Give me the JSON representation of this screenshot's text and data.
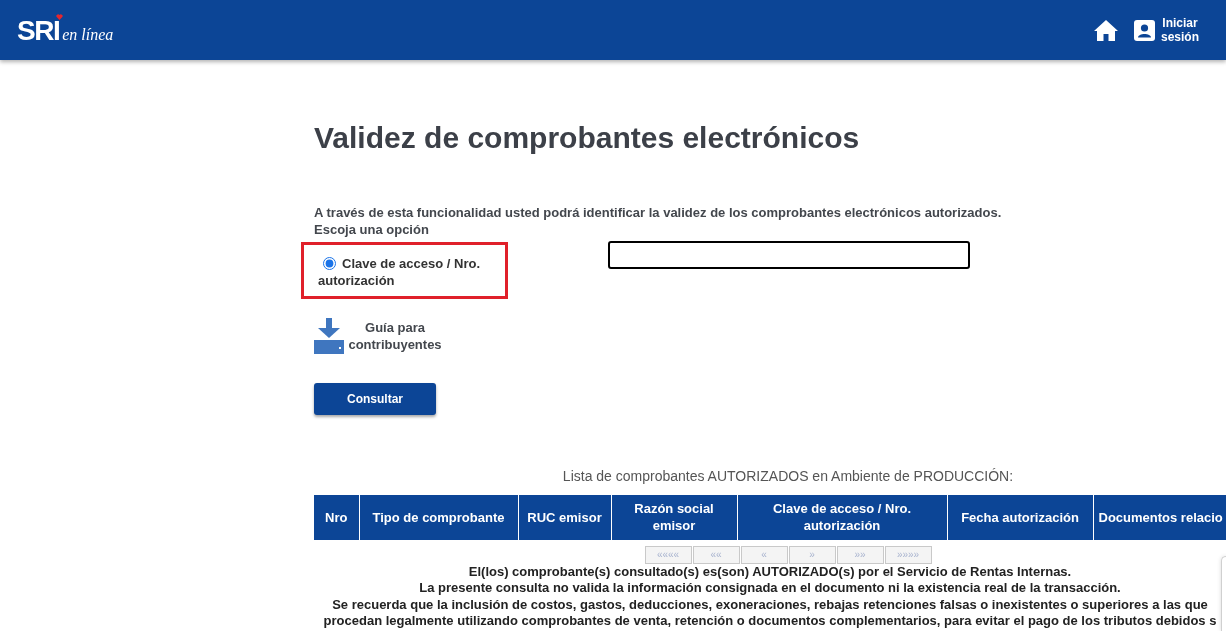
{
  "header": {
    "logo_text": "SRI",
    "logo_tagline": "en línea",
    "login_link": "Iniciar sesión"
  },
  "page_title": "Validez de comprobantes electrónicos",
  "intro": "A través de esta funcionalidad usted podrá identificar la validez de los comprobantes electrónicos autorizados.",
  "prompt": "Escoja una opción",
  "options": [
    {
      "label": "Clave de acceso / Nro. autorización",
      "selected": true,
      "highlighted": true
    }
  ],
  "guide_link": "Guía para contribuyentes",
  "submit_button": "Consultar",
  "results": {
    "caption": "Lista de comprobantes AUTORIZADOS en Ambiente de PRODUCCIÓN:",
    "columns": [
      "Nro",
      "Tipo de comprobante",
      "RUC emisor",
      "Razón social emisor",
      "Clave de acceso / Nro. autorización",
      "Fecha autorización",
      "Documentos relacio"
    ],
    "pagination": [
      {
        "label": "««««",
        "disabled": true
      },
      {
        "label": "««",
        "disabled": true
      },
      {
        "label": "«",
        "disabled": true
      },
      {
        "label": "»",
        "disabled": true
      },
      {
        "label": "»»",
        "disabled": true
      },
      {
        "label": "»»»»",
        "disabled": true
      }
    ],
    "notes": [
      "El(los) comprobante(s) consultado(s) es(son) AUTORIZADO(s) por el Servicio de Rentas Internas.",
      "La presente consulta no valida la información consignada en el documento ni la existencia real de la transacción.",
      "Se recuerda que la inclusión de costos, gastos, deducciones, exoneraciones, rebajas retenciones falsas o inexistentes o superiores a las que",
      "procedan legalmente utilizando comprobantes de venta, retención o documentos complementarios, para evitar el pago de los tributos debidos s"
    ]
  }
}
